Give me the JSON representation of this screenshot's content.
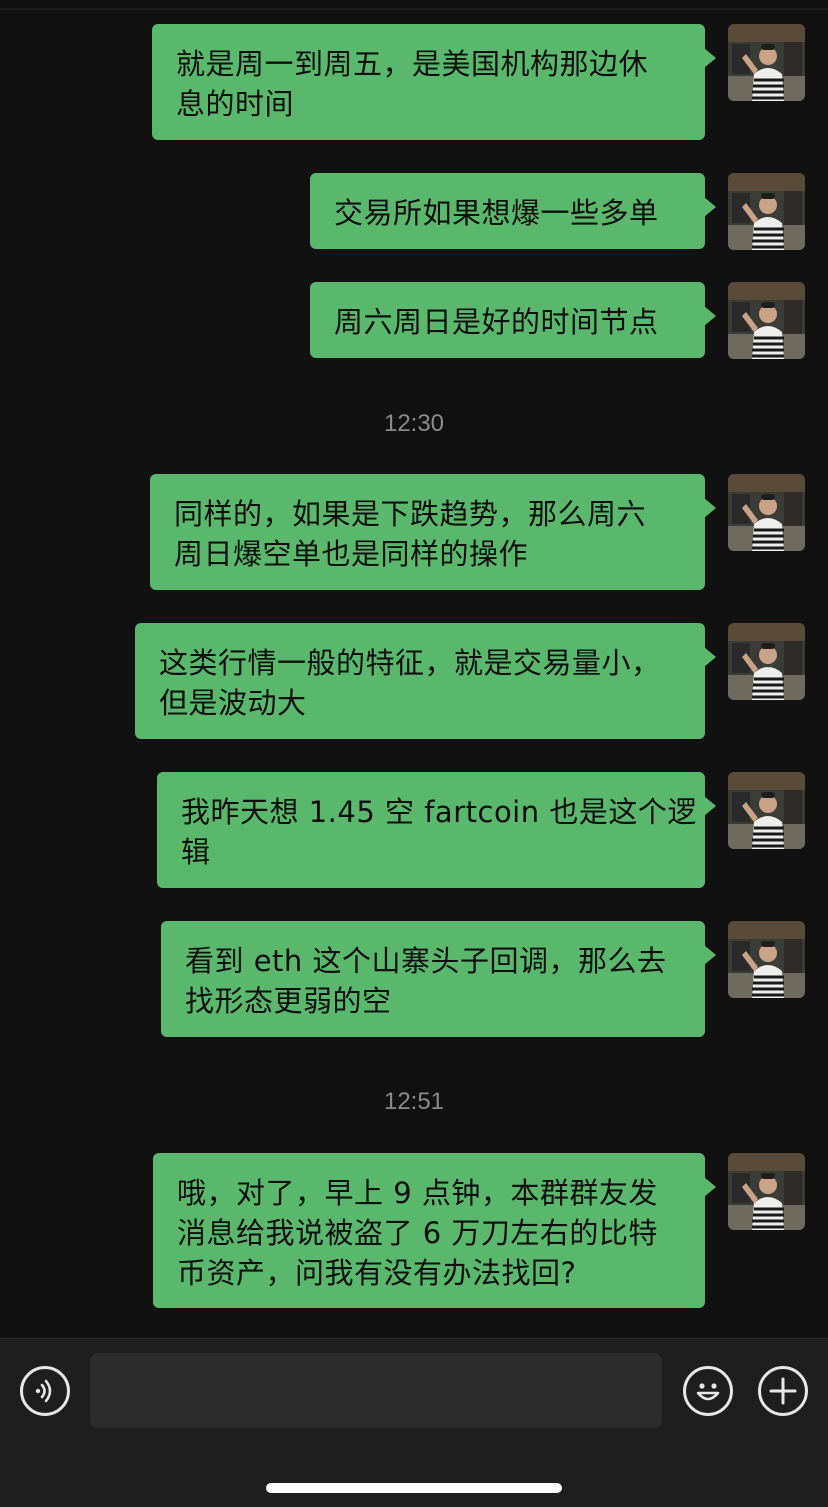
{
  "chat": {
    "messages": [
      {
        "lines": [
          "就是周一到周五，是美国机构那边休",
          "息的时间"
        ]
      },
      {
        "lines": [
          "交易所如果想爆一些多单"
        ]
      },
      {
        "lines": [
          "周六周日是好的时间节点"
        ]
      },
      {
        "lines": [
          "同样的，如果是下跌趋势，那么周六",
          "周日爆空单也是同样的操作"
        ]
      },
      {
        "lines": [
          "这类行情一般的特征，就是交易量小，",
          "但是波动大"
        ]
      },
      {
        "lines": [
          "我昨天想 1.45 空 fartcoin 也是这个逻",
          "辑"
        ]
      },
      {
        "lines": [
          "看到 eth 这个山寨头子回调，那么去",
          "找形态更弱的空"
        ]
      },
      {
        "lines": [
          "哦，对了，早上 9 点钟，本群群友发",
          "消息给我说被盗了 6 万刀左右的比特",
          "币资产，问我有没有办法找回?"
        ]
      }
    ],
    "timestamps": [
      "12:30",
      "12:51"
    ]
  },
  "input_bar": {
    "voice_icon": "voice-icon",
    "emoji_icon": "emoji-icon",
    "plus_icon": "plus-icon",
    "text_value": ""
  },
  "colors": {
    "bubble": "#5ab86d",
    "background": "#111111",
    "input_bar": "#1e1e1e"
  }
}
